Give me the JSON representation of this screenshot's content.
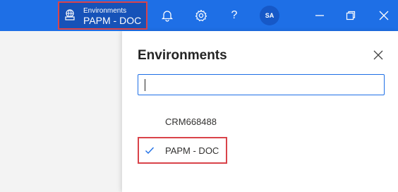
{
  "topbar": {
    "env_label": "Environments",
    "env_name": "PAPM - DOC",
    "avatar_initials": "SA",
    "help_glyph": "?",
    "color": "#1e6fe6"
  },
  "icons": {
    "environment": "globe-building-icon",
    "notifications": "bell-icon",
    "settings": "gear-icon",
    "help": "help-icon",
    "minimize": "minimize-icon",
    "restore": "restore-icon",
    "close": "close-icon",
    "check": "check-icon"
  },
  "panel": {
    "title": "Environments",
    "search_value": "",
    "options": [
      {
        "label": "CRM668488",
        "selected": false
      },
      {
        "label": "PAPM - DOC",
        "selected": true
      }
    ]
  }
}
